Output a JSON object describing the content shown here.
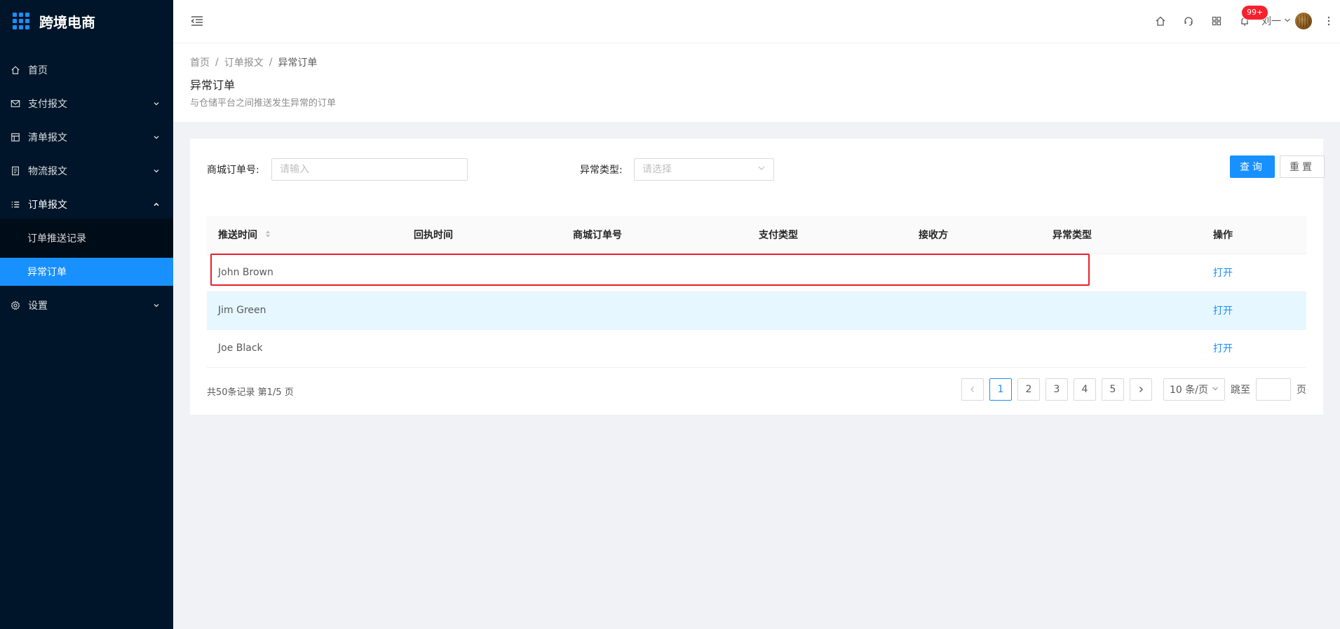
{
  "brand": {
    "name": "跨境电商"
  },
  "sidebar": {
    "items": [
      {
        "label": "首页",
        "icon": "home-icon",
        "has_children": false
      },
      {
        "label": "支付报文",
        "icon": "mail-icon",
        "has_children": true
      },
      {
        "label": "清单报文",
        "icon": "layout-icon",
        "has_children": true
      },
      {
        "label": "物流报文",
        "icon": "file-icon",
        "has_children": true
      },
      {
        "label": "订单报文",
        "icon": "list-icon",
        "has_children": true,
        "expanded": true,
        "children": [
          {
            "label": "订单推送记录",
            "active": false
          },
          {
            "label": "异常订单",
            "active": true
          }
        ]
      },
      {
        "label": "设置",
        "icon": "gear-icon",
        "has_children": true
      }
    ]
  },
  "header": {
    "notification_badge": "99+",
    "user_name": "刘一"
  },
  "breadcrumb": [
    "首页",
    "订单报文",
    "异常订单"
  ],
  "page": {
    "title": "异常订单",
    "description": "与仓储平台之间推送发生异常的订单"
  },
  "filter": {
    "order_no_label": "商城订单号:",
    "order_no_placeholder": "请输入",
    "exception_type_label": "异常类型:",
    "exception_type_placeholder": "请选择",
    "query_button": "查询",
    "reset_button": "重置"
  },
  "table": {
    "columns": [
      "推送时间",
      "回执时间",
      "商城订单号",
      "支付类型",
      "接收方",
      "异常类型",
      "操作"
    ],
    "rows": [
      {
        "name": "John Brown",
        "action": "打开"
      },
      {
        "name": "Jim Green",
        "action": "打开"
      },
      {
        "name": "Joe Black",
        "action": "打开"
      }
    ]
  },
  "pagination": {
    "total_text": "共50条记录 第1/5 页",
    "pages": [
      "1",
      "2",
      "3",
      "4",
      "5"
    ],
    "current_page": "1",
    "page_size": "10 条/页",
    "jump_label": "跳至",
    "jump_suffix": "页"
  },
  "colors": {
    "sidebar_bg": "#001529",
    "primary": "#1890ff",
    "highlight": "#e8202b",
    "badge": "#f5222d"
  }
}
